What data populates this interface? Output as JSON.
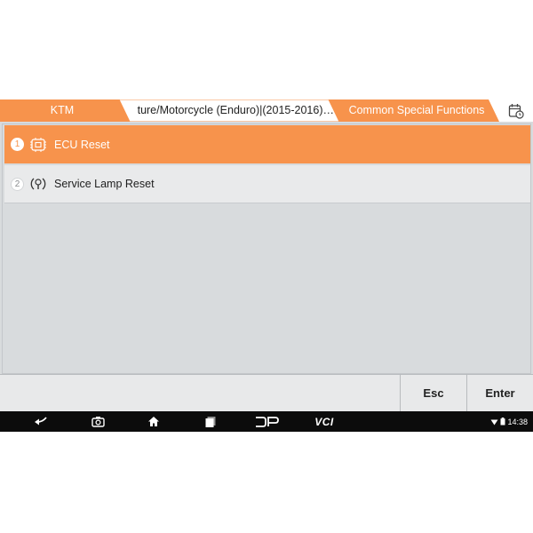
{
  "breadcrumb": {
    "items": [
      {
        "label": "KTM"
      },
      {
        "label": "…ture/Motorcycle (Enduro)|(2015-2016)"
      },
      {
        "label": "Common Special Functions"
      }
    ]
  },
  "menu": {
    "items": [
      {
        "number": "1",
        "label": "ECU Reset",
        "icon": "ecu-chip-icon",
        "selected": true
      },
      {
        "number": "2",
        "label": "Service Lamp Reset",
        "icon": "service-lamp-icon",
        "selected": false
      }
    ]
  },
  "toolbar": {
    "esc_label": "Esc",
    "enter_label": "Enter"
  },
  "navbar": {
    "dp_label": "DP",
    "vci_label": "VCI",
    "time": "14:38"
  },
  "colors": {
    "accent": "#f7934c",
    "background": "#d8dbdd",
    "navbar": "#0c0c0c"
  }
}
